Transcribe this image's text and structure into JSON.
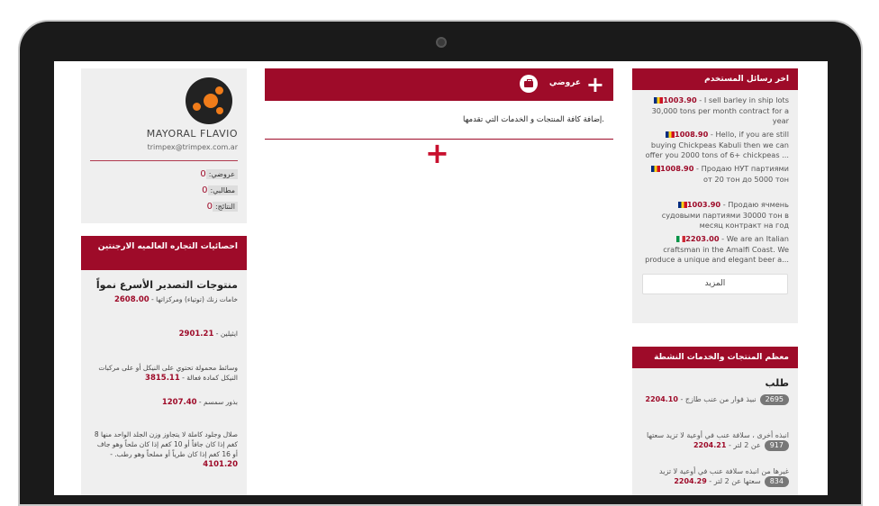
{
  "left": {
    "profile": {
      "name": "MAYORAL FLAVIO",
      "email": "trimpex@trimpex.com.ar",
      "stats": [
        {
          "label": "عروضي:",
          "count": "0"
        },
        {
          "label": "مطالبي:",
          "count": "0"
        },
        {
          "label": "النتائج:",
          "count": "0"
        }
      ]
    },
    "stats_box": {
      "header": "احصائيات التجاره العالميه الارجنتين",
      "title": "منتوجات التصدير الأسرع نمواً",
      "items": [
        {
          "price": "2608.00",
          "text": "خامات زنك (توتياء) ومركزاتها"
        },
        {
          "price": "2901.21",
          "text": "ايثيلين"
        },
        {
          "price": "3815.11",
          "text": "وسائط محمولة تحتوي على النيكل أو على مركبات النيكل كمادة فعالة"
        },
        {
          "price": "1207.40",
          "text": "بذور سمسم"
        },
        {
          "price": "4101.20",
          "text": "صلال وجلود كاملة لا يتجاوز وزن الجلد الواحد منها 8 كغم إذا كان جافاً أو 10 كغم إذا كان ملحاً وهو جاف أو 16 كغم إذا كان طرياً أو مملحاً وهو رطب."
        }
      ]
    }
  },
  "middle": {
    "header_label": "عروضي",
    "description": "إضافة كافة المنتجات و الخدمات التي تقدمها."
  },
  "right": {
    "messages_box": {
      "header": "اخر رسائل المستخدم",
      "messages": [
        {
          "price": "1003.90",
          "text": "I sell barley in ship lots 30,000 tons per month contract for a year",
          "flag": "ro"
        },
        {
          "price": "1008.90",
          "text": "Hello, if you are still buying Chickpeas Kabuli then we can offer you 2000 tons of 6+ chickpeas ...",
          "flag": "ro"
        },
        {
          "price": "1008.90",
          "text": "Продаю НУТ партиями от 20 тон до 5000 тон",
          "flag": "ro"
        },
        {
          "price": "1003.90",
          "text": "Продаю ячмень судовыми партиями 30000 тон в месяц контракт на год",
          "flag": "ro"
        },
        {
          "price": "2203.00",
          "text": "We are an Italian craftsman in the Amalfi Coast. We produce a unique and elegant beer a...",
          "flag": "it"
        }
      ],
      "more_label": "المزيد"
    },
    "active_box": {
      "header": "معظم المنتجات والخدمات النشطة",
      "title": "طلب",
      "items": [
        {
          "count": "2695",
          "price": "2204.10",
          "text": "نبيذ فوار من عنب طازج"
        },
        {
          "count": "917",
          "price": "2204.21",
          "text": "انبذه أخرى ، سلافة عنب في أوعية لا تزيد سعتها عن 2 لتر"
        },
        {
          "count": "834",
          "price": "2204.29",
          "text": "غيرها من انبذه سلافة عنب في أوعية لا تزيد سعتها عن 2 لتر"
        }
      ]
    }
  },
  "colors": {
    "accent": "#9e0b29",
    "panel": "#efefef"
  }
}
